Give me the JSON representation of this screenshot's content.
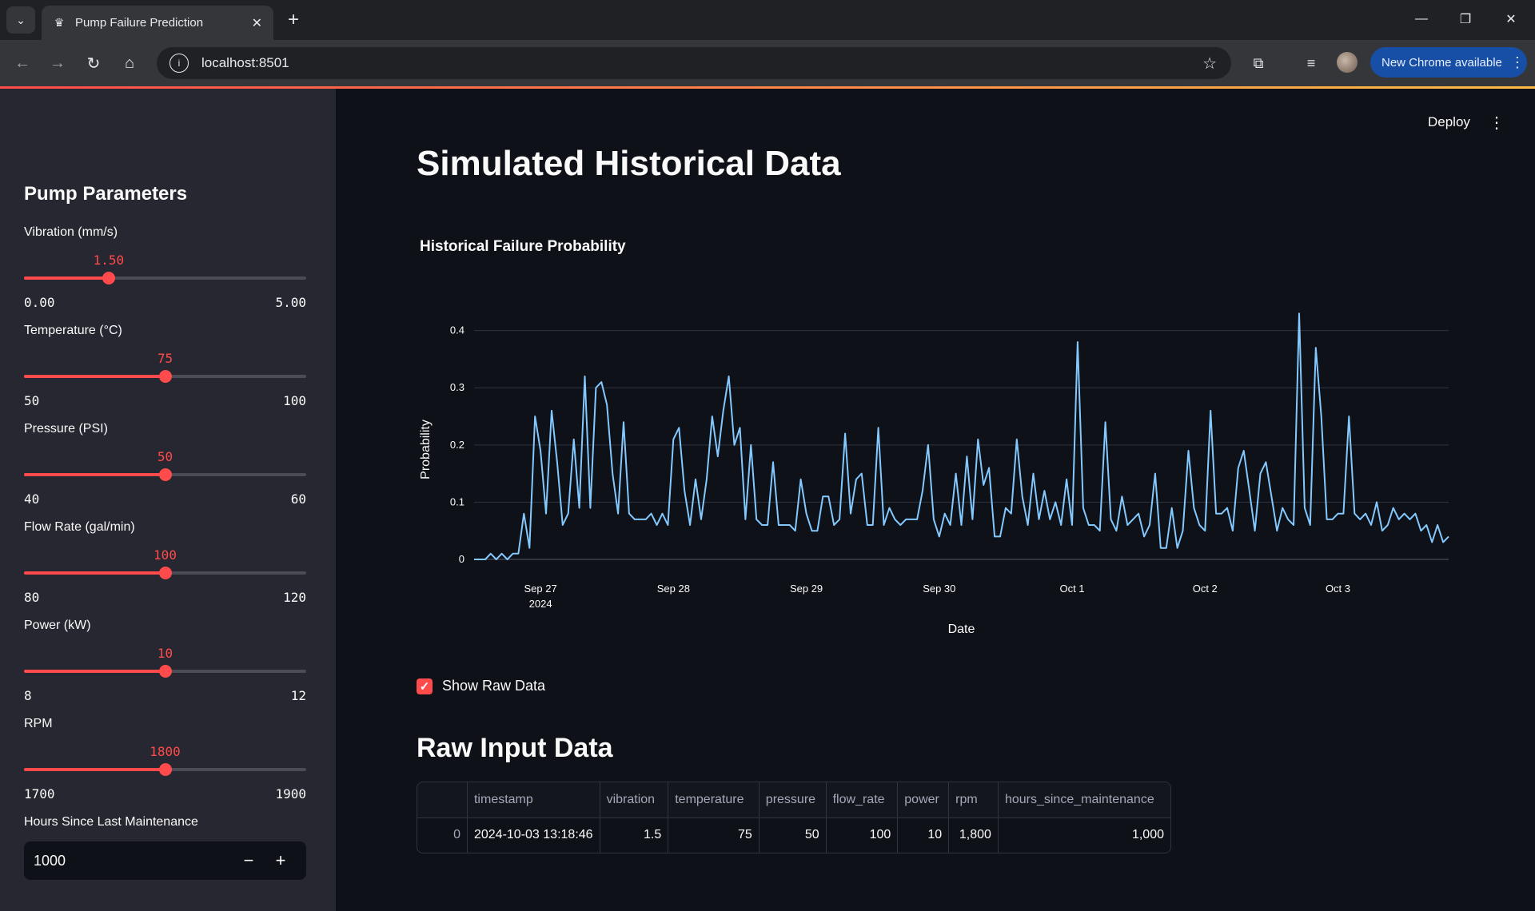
{
  "browser": {
    "tab_title": "Pump Failure Prediction",
    "url": "localhost:8501",
    "update_button": "New Chrome available"
  },
  "header": {
    "deploy_label": "Deploy"
  },
  "sidebar": {
    "title": "Pump Parameters",
    "sliders": [
      {
        "label": "Vibration (mm/s)",
        "value": "1.50",
        "min": "0.00",
        "max": "5.00",
        "fraction": 0.3
      },
      {
        "label": "Temperature (°C)",
        "value": "75",
        "min": "50",
        "max": "100",
        "fraction": 0.5
      },
      {
        "label": "Pressure (PSI)",
        "value": "50",
        "min": "40",
        "max": "60",
        "fraction": 0.5
      },
      {
        "label": "Flow Rate (gal/min)",
        "value": "100",
        "min": "80",
        "max": "120",
        "fraction": 0.5
      },
      {
        "label": "Power (kW)",
        "value": "10",
        "min": "8",
        "max": "12",
        "fraction": 0.5
      },
      {
        "label": "RPM",
        "value": "1800",
        "min": "1700",
        "max": "1900",
        "fraction": 0.5
      }
    ],
    "hours_label": "Hours Since Last Maintenance",
    "hours_value": "1000"
  },
  "main": {
    "title": "Simulated Historical Data",
    "chart_title": "Historical Failure Probability",
    "show_raw_label": "Show Raw Data",
    "raw_title": "Raw Input Data",
    "table": {
      "columns": [
        "",
        "timestamp",
        "vibration",
        "temperature",
        "pressure",
        "flow_rate",
        "power",
        "rpm",
        "hours_since_maintenance"
      ],
      "rows": [
        [
          "0",
          "2024-10-03 13:18:46",
          "1.5",
          "75",
          "50",
          "100",
          "10",
          "1,800",
          "1,000"
        ]
      ]
    }
  },
  "chart_data": {
    "type": "line",
    "title": "Historical Failure Probability",
    "xlabel": "Date",
    "ylabel": "Probability",
    "x_start": "2024-09-26 12:00",
    "x_step_hours": 1,
    "x_tick_labels": [
      "Sep 27\n2024",
      "Sep 28",
      "Sep 29",
      "Sep 30",
      "Oct 1",
      "Oct 2",
      "Oct 3"
    ],
    "y_ticks": [
      0,
      0.1,
      0.2,
      0.3,
      0.4
    ],
    "ylim": [
      0,
      0.44
    ],
    "color": "#83c9ff",
    "series": [
      {
        "values": [
          0.0,
          0.0,
          0.0,
          0.01,
          0.0,
          0.01,
          0.0,
          0.01,
          0.01,
          0.08,
          0.02,
          0.25,
          0.19,
          0.08,
          0.26,
          0.17,
          0.06,
          0.08,
          0.21,
          0.09,
          0.32,
          0.09,
          0.3,
          0.31,
          0.27,
          0.15,
          0.08,
          0.24,
          0.08,
          0.07,
          0.07,
          0.07,
          0.08,
          0.06,
          0.08,
          0.06,
          0.21,
          0.23,
          0.12,
          0.06,
          0.14,
          0.07,
          0.14,
          0.25,
          0.18,
          0.26,
          0.32,
          0.2,
          0.23,
          0.07,
          0.2,
          0.07,
          0.06,
          0.06,
          0.17,
          0.06,
          0.06,
          0.06,
          0.05,
          0.14,
          0.08,
          0.05,
          0.05,
          0.11,
          0.11,
          0.06,
          0.07,
          0.22,
          0.08,
          0.14,
          0.15,
          0.06,
          0.06,
          0.23,
          0.06,
          0.09,
          0.07,
          0.06,
          0.07,
          0.07,
          0.07,
          0.12,
          0.2,
          0.07,
          0.04,
          0.08,
          0.06,
          0.15,
          0.06,
          0.18,
          0.07,
          0.21,
          0.13,
          0.16,
          0.04,
          0.04,
          0.09,
          0.08,
          0.21,
          0.11,
          0.06,
          0.15,
          0.07,
          0.12,
          0.07,
          0.1,
          0.06,
          0.14,
          0.06,
          0.38,
          0.09,
          0.06,
          0.06,
          0.05,
          0.24,
          0.07,
          0.05,
          0.11,
          0.06,
          0.07,
          0.08,
          0.04,
          0.06,
          0.15,
          0.02,
          0.02,
          0.09,
          0.02,
          0.05,
          0.19,
          0.09,
          0.06,
          0.05,
          0.26,
          0.08,
          0.08,
          0.09,
          0.05,
          0.16,
          0.19,
          0.12,
          0.05,
          0.15,
          0.17,
          0.11,
          0.05,
          0.09,
          0.07,
          0.06,
          0.43,
          0.09,
          0.06,
          0.37,
          0.25,
          0.07,
          0.07,
          0.08,
          0.08,
          0.25,
          0.08,
          0.07,
          0.08,
          0.06,
          0.1,
          0.05,
          0.06,
          0.09,
          0.07,
          0.08,
          0.07,
          0.08,
          0.05,
          0.06,
          0.03,
          0.06,
          0.03,
          0.04
        ]
      }
    ]
  }
}
